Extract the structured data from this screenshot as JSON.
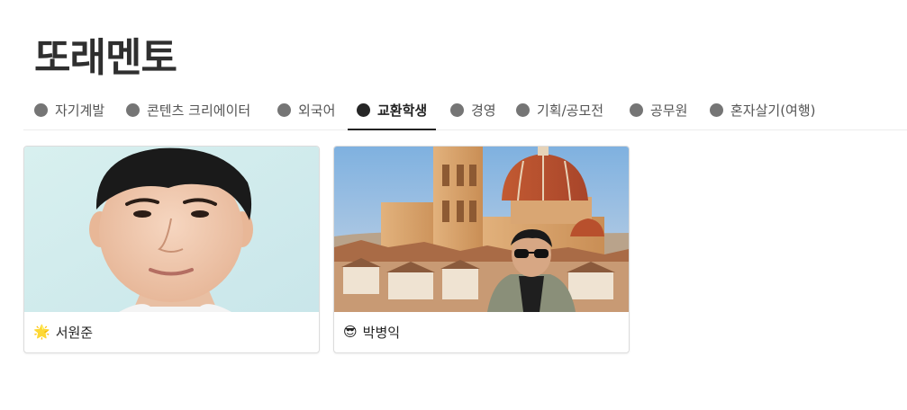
{
  "site": {
    "title": "또래멘토"
  },
  "tabs": [
    {
      "label": "자기계발",
      "active": false
    },
    {
      "label": "콘텐츠 크리에이터",
      "active": false
    },
    {
      "label": "외국어",
      "active": false
    },
    {
      "label": "교환학생",
      "active": true
    },
    {
      "label": "경영",
      "active": false
    },
    {
      "label": "기획/공모전",
      "active": false
    },
    {
      "label": "공무원",
      "active": false
    },
    {
      "label": "혼자살기(여행)",
      "active": false
    }
  ],
  "cards": [
    {
      "name": "서원준",
      "emoji": "🌟"
    },
    {
      "name": "박병익",
      "emoji": "😎"
    }
  ]
}
